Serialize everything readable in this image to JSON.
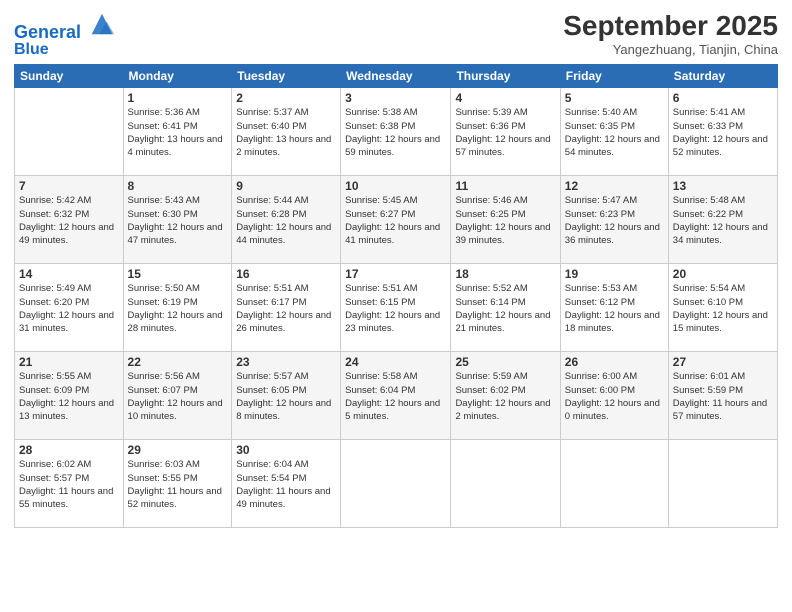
{
  "header": {
    "logo_line1": "General",
    "logo_line2": "Blue",
    "month_year": "September 2025",
    "location": "Yangezhuang, Tianjin, China"
  },
  "days_of_week": [
    "Sunday",
    "Monday",
    "Tuesday",
    "Wednesday",
    "Thursday",
    "Friday",
    "Saturday"
  ],
  "weeks": [
    [
      {
        "day": "",
        "sunrise": "",
        "sunset": "",
        "daylight": ""
      },
      {
        "day": "1",
        "sunrise": "Sunrise: 5:36 AM",
        "sunset": "Sunset: 6:41 PM",
        "daylight": "Daylight: 13 hours and 4 minutes."
      },
      {
        "day": "2",
        "sunrise": "Sunrise: 5:37 AM",
        "sunset": "Sunset: 6:40 PM",
        "daylight": "Daylight: 13 hours and 2 minutes."
      },
      {
        "day": "3",
        "sunrise": "Sunrise: 5:38 AM",
        "sunset": "Sunset: 6:38 PM",
        "daylight": "Daylight: 12 hours and 59 minutes."
      },
      {
        "day": "4",
        "sunrise": "Sunrise: 5:39 AM",
        "sunset": "Sunset: 6:36 PM",
        "daylight": "Daylight: 12 hours and 57 minutes."
      },
      {
        "day": "5",
        "sunrise": "Sunrise: 5:40 AM",
        "sunset": "Sunset: 6:35 PM",
        "daylight": "Daylight: 12 hours and 54 minutes."
      },
      {
        "day": "6",
        "sunrise": "Sunrise: 5:41 AM",
        "sunset": "Sunset: 6:33 PM",
        "daylight": "Daylight: 12 hours and 52 minutes."
      }
    ],
    [
      {
        "day": "7",
        "sunrise": "Sunrise: 5:42 AM",
        "sunset": "Sunset: 6:32 PM",
        "daylight": "Daylight: 12 hours and 49 minutes."
      },
      {
        "day": "8",
        "sunrise": "Sunrise: 5:43 AM",
        "sunset": "Sunset: 6:30 PM",
        "daylight": "Daylight: 12 hours and 47 minutes."
      },
      {
        "day": "9",
        "sunrise": "Sunrise: 5:44 AM",
        "sunset": "Sunset: 6:28 PM",
        "daylight": "Daylight: 12 hours and 44 minutes."
      },
      {
        "day": "10",
        "sunrise": "Sunrise: 5:45 AM",
        "sunset": "Sunset: 6:27 PM",
        "daylight": "Daylight: 12 hours and 41 minutes."
      },
      {
        "day": "11",
        "sunrise": "Sunrise: 5:46 AM",
        "sunset": "Sunset: 6:25 PM",
        "daylight": "Daylight: 12 hours and 39 minutes."
      },
      {
        "day": "12",
        "sunrise": "Sunrise: 5:47 AM",
        "sunset": "Sunset: 6:23 PM",
        "daylight": "Daylight: 12 hours and 36 minutes."
      },
      {
        "day": "13",
        "sunrise": "Sunrise: 5:48 AM",
        "sunset": "Sunset: 6:22 PM",
        "daylight": "Daylight: 12 hours and 34 minutes."
      }
    ],
    [
      {
        "day": "14",
        "sunrise": "Sunrise: 5:49 AM",
        "sunset": "Sunset: 6:20 PM",
        "daylight": "Daylight: 12 hours and 31 minutes."
      },
      {
        "day": "15",
        "sunrise": "Sunrise: 5:50 AM",
        "sunset": "Sunset: 6:19 PM",
        "daylight": "Daylight: 12 hours and 28 minutes."
      },
      {
        "day": "16",
        "sunrise": "Sunrise: 5:51 AM",
        "sunset": "Sunset: 6:17 PM",
        "daylight": "Daylight: 12 hours and 26 minutes."
      },
      {
        "day": "17",
        "sunrise": "Sunrise: 5:51 AM",
        "sunset": "Sunset: 6:15 PM",
        "daylight": "Daylight: 12 hours and 23 minutes."
      },
      {
        "day": "18",
        "sunrise": "Sunrise: 5:52 AM",
        "sunset": "Sunset: 6:14 PM",
        "daylight": "Daylight: 12 hours and 21 minutes."
      },
      {
        "day": "19",
        "sunrise": "Sunrise: 5:53 AM",
        "sunset": "Sunset: 6:12 PM",
        "daylight": "Daylight: 12 hours and 18 minutes."
      },
      {
        "day": "20",
        "sunrise": "Sunrise: 5:54 AM",
        "sunset": "Sunset: 6:10 PM",
        "daylight": "Daylight: 12 hours and 15 minutes."
      }
    ],
    [
      {
        "day": "21",
        "sunrise": "Sunrise: 5:55 AM",
        "sunset": "Sunset: 6:09 PM",
        "daylight": "Daylight: 12 hours and 13 minutes."
      },
      {
        "day": "22",
        "sunrise": "Sunrise: 5:56 AM",
        "sunset": "Sunset: 6:07 PM",
        "daylight": "Daylight: 12 hours and 10 minutes."
      },
      {
        "day": "23",
        "sunrise": "Sunrise: 5:57 AM",
        "sunset": "Sunset: 6:05 PM",
        "daylight": "Daylight: 12 hours and 8 minutes."
      },
      {
        "day": "24",
        "sunrise": "Sunrise: 5:58 AM",
        "sunset": "Sunset: 6:04 PM",
        "daylight": "Daylight: 12 hours and 5 minutes."
      },
      {
        "day": "25",
        "sunrise": "Sunrise: 5:59 AM",
        "sunset": "Sunset: 6:02 PM",
        "daylight": "Daylight: 12 hours and 2 minutes."
      },
      {
        "day": "26",
        "sunrise": "Sunrise: 6:00 AM",
        "sunset": "Sunset: 6:00 PM",
        "daylight": "Daylight: 12 hours and 0 minutes."
      },
      {
        "day": "27",
        "sunrise": "Sunrise: 6:01 AM",
        "sunset": "Sunset: 5:59 PM",
        "daylight": "Daylight: 11 hours and 57 minutes."
      }
    ],
    [
      {
        "day": "28",
        "sunrise": "Sunrise: 6:02 AM",
        "sunset": "Sunset: 5:57 PM",
        "daylight": "Daylight: 11 hours and 55 minutes."
      },
      {
        "day": "29",
        "sunrise": "Sunrise: 6:03 AM",
        "sunset": "Sunset: 5:55 PM",
        "daylight": "Daylight: 11 hours and 52 minutes."
      },
      {
        "day": "30",
        "sunrise": "Sunrise: 6:04 AM",
        "sunset": "Sunset: 5:54 PM",
        "daylight": "Daylight: 11 hours and 49 minutes."
      },
      {
        "day": "",
        "sunrise": "",
        "sunset": "",
        "daylight": ""
      },
      {
        "day": "",
        "sunrise": "",
        "sunset": "",
        "daylight": ""
      },
      {
        "day": "",
        "sunrise": "",
        "sunset": "",
        "daylight": ""
      },
      {
        "day": "",
        "sunrise": "",
        "sunset": "",
        "daylight": ""
      }
    ]
  ]
}
